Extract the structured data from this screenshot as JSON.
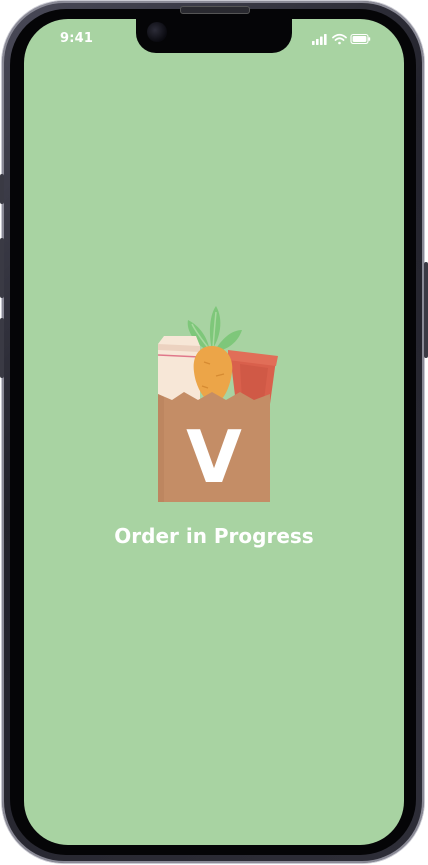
{
  "status_bar": {
    "time": "9:41",
    "icons": [
      "signal-icon",
      "wifi-icon",
      "battery-icon"
    ]
  },
  "main": {
    "title": "Order in Progress",
    "logo_letter": "V",
    "logo_icon": "grocery-bag-icon"
  },
  "colors": {
    "screen_background": "#a8d3a2",
    "bag": "#c48d66",
    "carrot": "#eca548",
    "leaves": "#7ec77a",
    "pot": "#d9604c",
    "milk": "#f7e7d7",
    "text": "#ffffff"
  }
}
